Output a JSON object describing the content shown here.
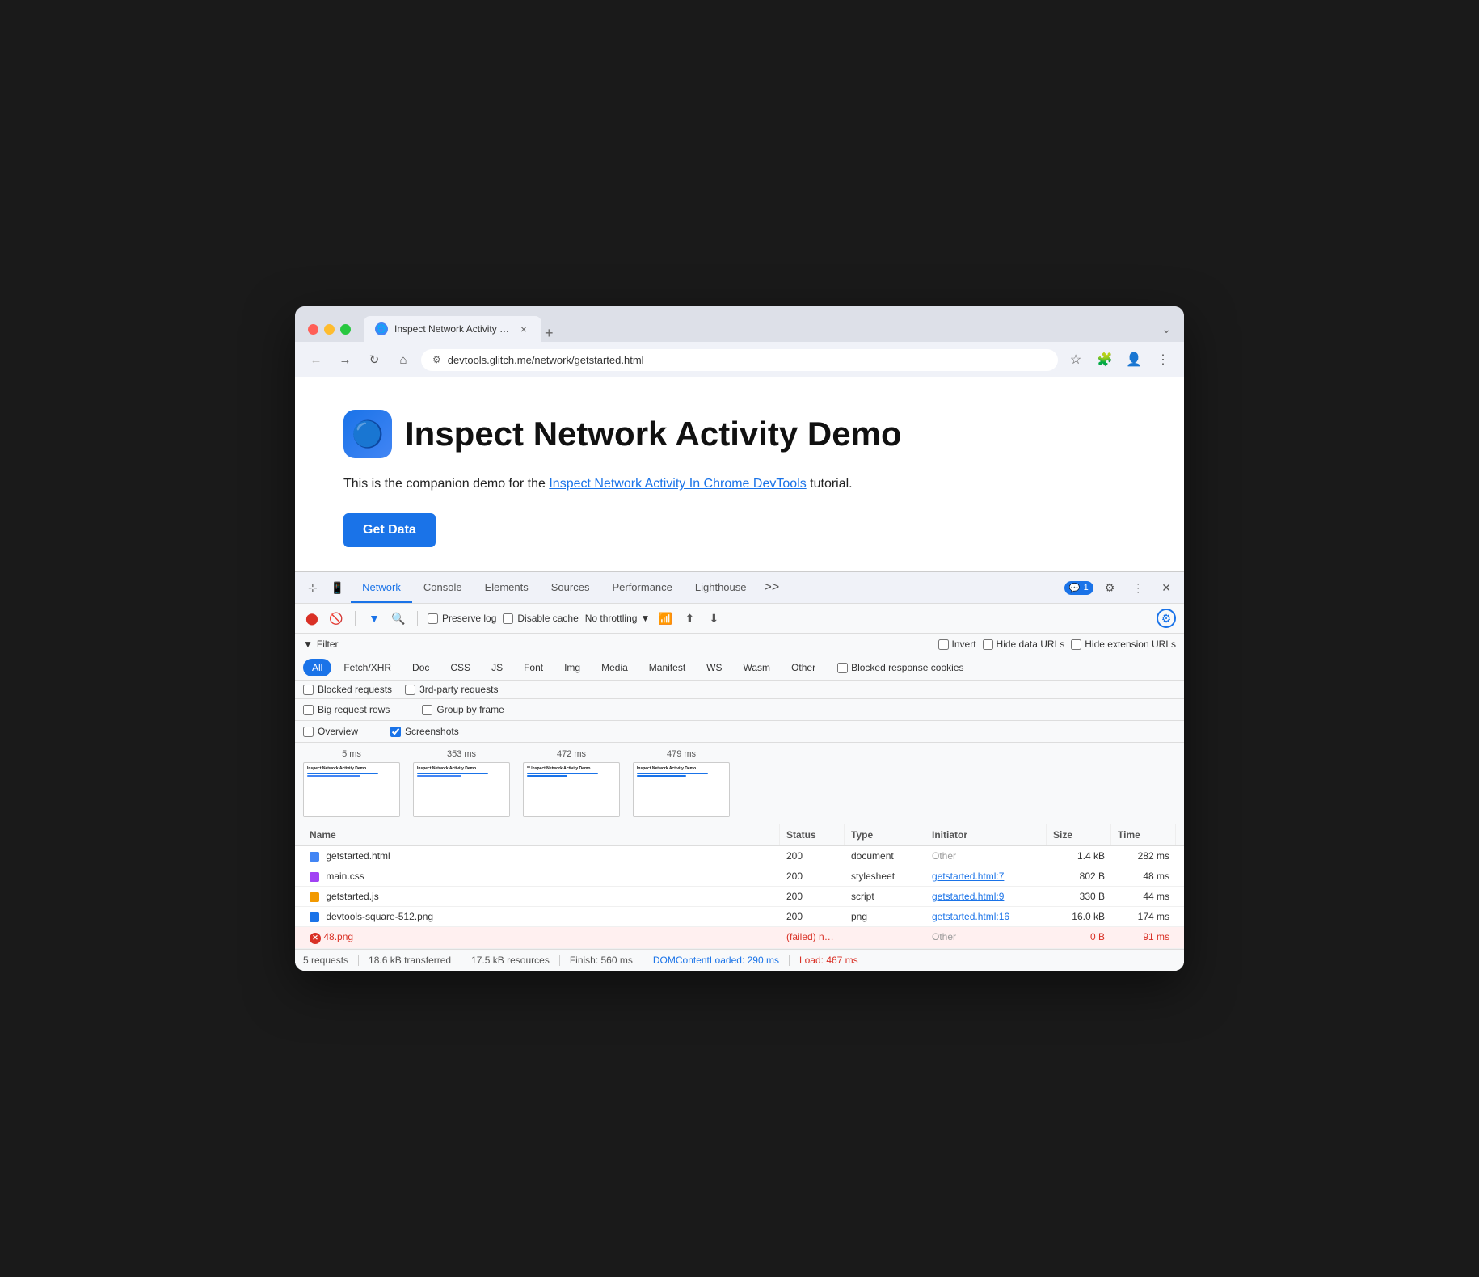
{
  "browser": {
    "title": "Inspect Network Activity Dem",
    "url": "devtools.glitch.me/network/getstarted.html",
    "tab_close": "×",
    "tab_new": "+",
    "tab_dropdown": "⌄"
  },
  "page": {
    "heading": "Inspect Network Activity Demo",
    "description_before": "This is the companion demo for the ",
    "link_text": "Inspect Network Activity In Chrome DevTools",
    "description_after": " tutorial.",
    "button": "Get Data"
  },
  "devtools": {
    "tabs": [
      "Network",
      "Console",
      "Elements",
      "Sources",
      "Performance",
      "Lighthouse"
    ],
    "tab_more": ">>",
    "chat_badge": "1",
    "active_tab": "Network"
  },
  "network_toolbar": {
    "preserve_log": "Preserve log",
    "disable_cache": "Disable cache",
    "throttle": "No throttling"
  },
  "filter_bar": {
    "filter_label": "Filter",
    "invert": "Invert",
    "hide_data_urls": "Hide data URLs",
    "hide_extension_urls": "Hide extension URLs"
  },
  "type_filters": [
    "All",
    "Fetch/XHR",
    "Doc",
    "CSS",
    "JS",
    "Font",
    "Img",
    "Media",
    "Manifest",
    "WS",
    "Wasm",
    "Other"
  ],
  "type_filters_active": "All",
  "extra_checks": {
    "blocked_response_cookies": "Blocked response cookies",
    "blocked_requests": "Blocked requests",
    "third_party": "3rd-party requests"
  },
  "options": {
    "big_request_rows": "Big request rows",
    "group_by_frame": "Group by frame",
    "overview": "Overview",
    "screenshots": "Screenshots"
  },
  "screenshots": [
    {
      "time": "5 ms"
    },
    {
      "time": "353 ms"
    },
    {
      "time": "472 ms"
    },
    {
      "time": "479 ms"
    }
  ],
  "table": {
    "headers": [
      "Name",
      "Status",
      "Type",
      "Initiator",
      "Size",
      "Time"
    ],
    "rows": [
      {
        "icon_type": "html",
        "name": "getstarted.html",
        "status": "200",
        "type": "document",
        "initiator": "Other",
        "initiator_link": false,
        "size": "1.4 kB",
        "time": "282 ms",
        "is_error": false
      },
      {
        "icon_type": "css",
        "name": "main.css",
        "status": "200",
        "type": "stylesheet",
        "initiator": "getstarted.html:7",
        "initiator_link": true,
        "size": "802 B",
        "time": "48 ms",
        "is_error": false
      },
      {
        "icon_type": "js",
        "name": "getstarted.js",
        "status": "200",
        "type": "script",
        "initiator": "getstarted.html:9",
        "initiator_link": true,
        "size": "330 B",
        "time": "44 ms",
        "is_error": false
      },
      {
        "icon_type": "png",
        "name": "devtools-square-512.png",
        "status": "200",
        "type": "png",
        "initiator": "getstarted.html:16",
        "initiator_link": true,
        "size": "16.0 kB",
        "time": "174 ms",
        "is_error": false
      },
      {
        "icon_type": "error",
        "name": "48.png",
        "status": "(failed) net::...",
        "type": "",
        "initiator": "Other",
        "initiator_link": false,
        "size": "0 B",
        "time": "91 ms",
        "is_error": true
      }
    ]
  },
  "status_bar": {
    "requests": "5 requests",
    "transferred": "18.6 kB transferred",
    "resources": "17.5 kB resources",
    "finish": "Finish: 560 ms",
    "dom_content_loaded": "DOMContentLoaded: 290 ms",
    "load": "Load: 467 ms"
  }
}
